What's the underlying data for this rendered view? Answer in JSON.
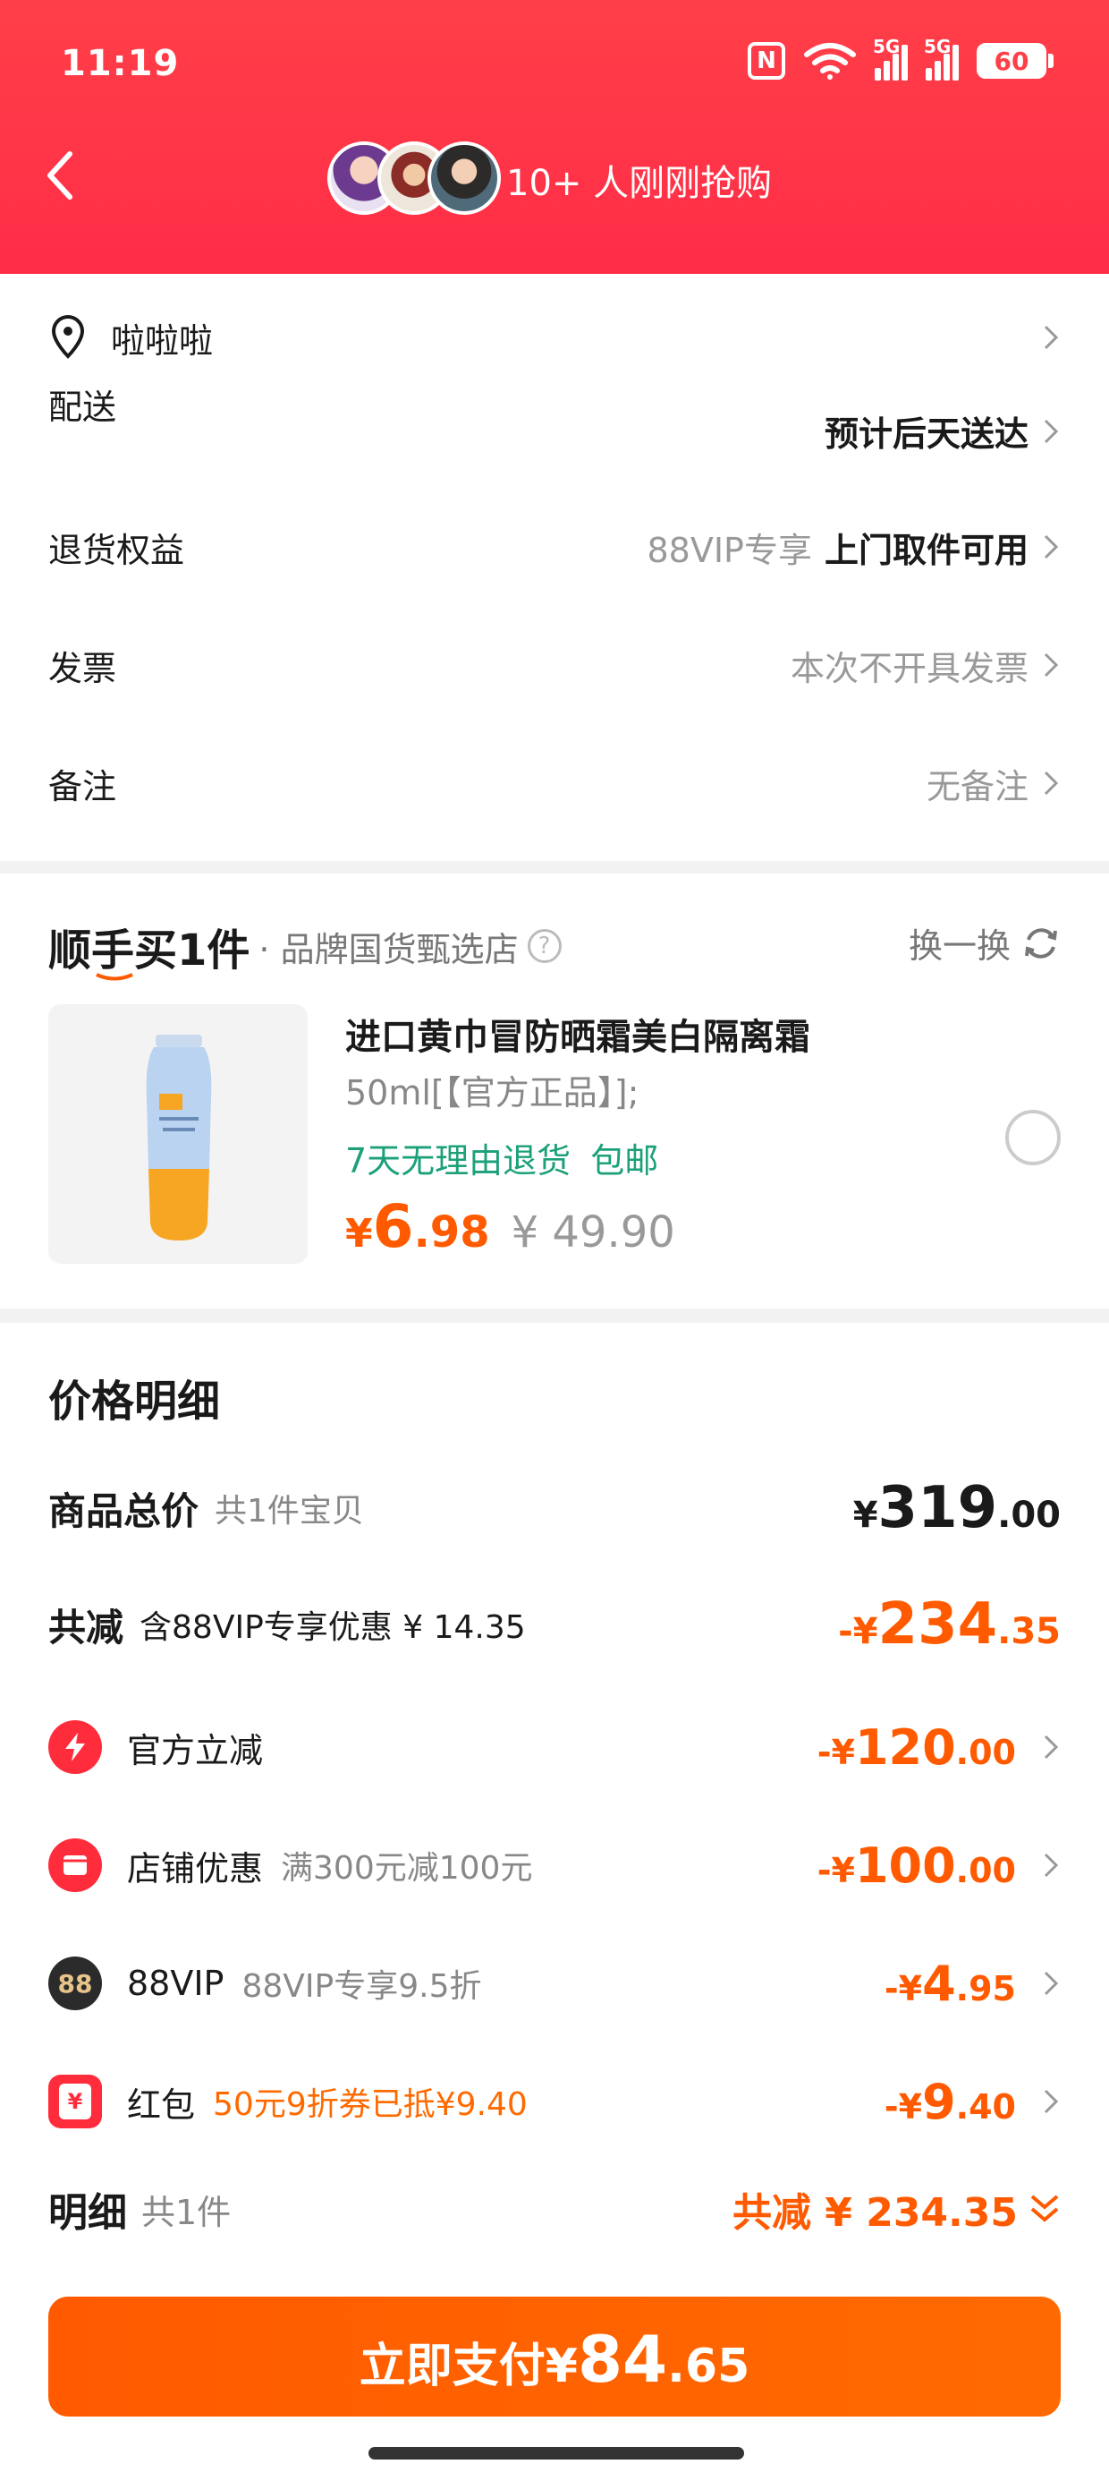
{
  "status_bar": {
    "time": "11:19",
    "nfc_label": "N",
    "network_5g_1": "5G",
    "network_5g_2": "5G",
    "battery": "60"
  },
  "header": {
    "buy_count_text": "10+ 人刚刚抢购"
  },
  "order_info": {
    "address": "啦啦啦",
    "delivery_label": "配送",
    "delivery_value": "预计后天送达",
    "return_label": "退货权益",
    "return_badge": "88VIP专享",
    "return_value": "上门取件可用",
    "invoice_label": "发票",
    "invoice_value": "本次不开具发票",
    "remark_label": "备注",
    "remark_value": "无备注"
  },
  "add_on": {
    "title": "顺手买1件",
    "shop": "· 品牌国货甄选店",
    "help_icon": "?",
    "swap_label": "换一换",
    "product_title": "进口黄巾冒防晒霜美白隔离霜",
    "product_spec": "50ml[【官方正品】];",
    "tags": [
      "7天无理由退货",
      "包邮"
    ],
    "price_symbol": "¥",
    "price_int": "6",
    "price_dec": ".98",
    "original_price": "¥ 49.90"
  },
  "price_detail": {
    "title": "价格明细",
    "total_label": "商品总价",
    "total_sub": "共1件宝贝",
    "total_symbol": "¥",
    "total_int": "319",
    "total_dec": ".00",
    "discount_label": "共减",
    "discount_sub": "含88VIP专享优惠 ¥ 14.35",
    "discount_symbol": "-¥",
    "discount_int": "234",
    "discount_dec": ".35",
    "items": [
      {
        "label": "官方立减",
        "sub": "",
        "amount_symbol": "-¥",
        "amount_int": "120",
        "amount_dec": ".00",
        "icon_text": ""
      },
      {
        "label": "店铺优惠",
        "sub": "满300元减100元",
        "amount_symbol": "-¥",
        "amount_int": "100",
        "amount_dec": ".00",
        "icon_text": ""
      },
      {
        "label": "88VIP",
        "sub": "88VIP专享9.5折",
        "amount_symbol": "-¥",
        "amount_int": "4",
        "amount_dec": ".95",
        "icon_text": "88"
      },
      {
        "label": "红包",
        "sub": "50元9折券已抵¥9.40",
        "amount_symbol": "-¥",
        "amount_int": "9",
        "amount_dec": ".40",
        "icon_text": "¥"
      }
    ],
    "detail_label": "明细",
    "detail_sub": "共1件",
    "detail_total": "共减 ¥ 234.35"
  },
  "pay_button": {
    "label": "立即支付",
    "symbol": "¥",
    "int": "84",
    "dec": ".65"
  },
  "colors": {
    "header_red": "#ff3f48",
    "accent_orange": "#ff5a00",
    "tag_green": "#1ca07a"
  }
}
